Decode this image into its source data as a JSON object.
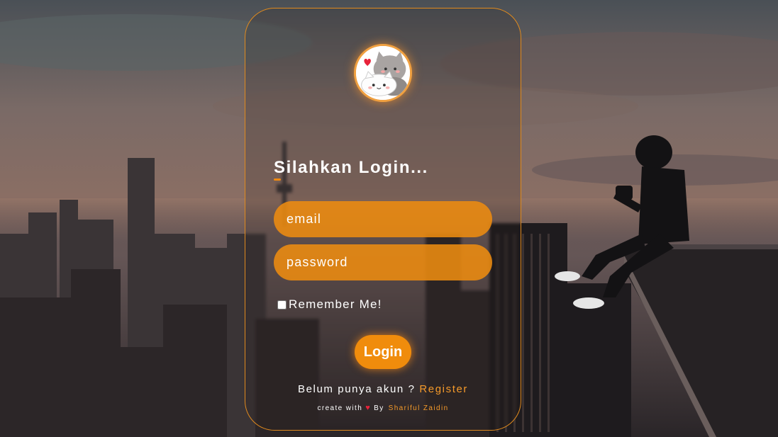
{
  "login": {
    "title": "Silahkan Login...",
    "email_placeholder": "email",
    "password_placeholder": "password",
    "remember_label": "Remember Me!",
    "login_button": "Login",
    "register_prompt": "Belum punya akun ?",
    "register_link": "Register"
  },
  "footer": {
    "prefix": "create with",
    "heart": "♥",
    "by": "By",
    "author": "Shariful Zaidin"
  },
  "colors": {
    "accent": "#f08c0c",
    "link": "#f59a2a",
    "heart": "#e8223a"
  },
  "icons": {
    "avatar": "cat-avatar-icon",
    "heart": "heart-icon"
  }
}
